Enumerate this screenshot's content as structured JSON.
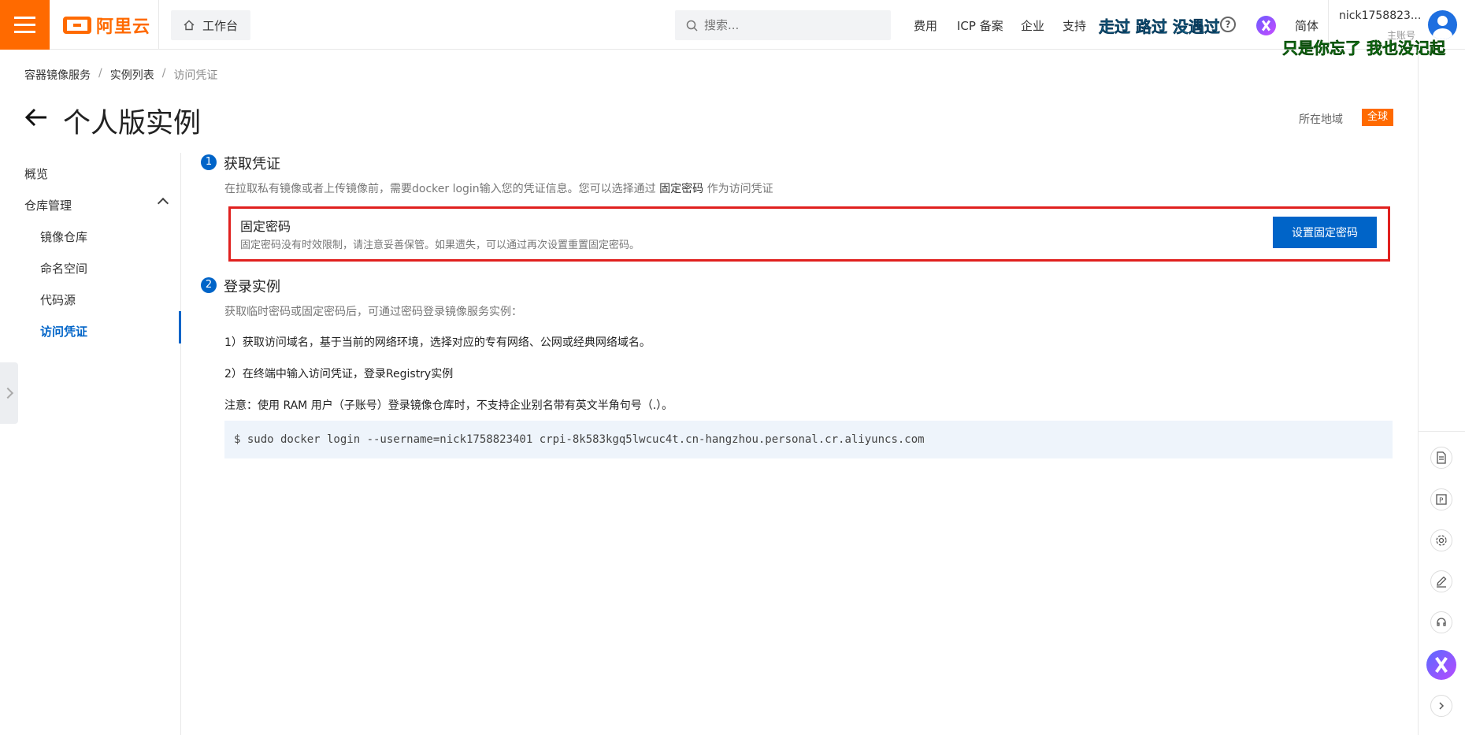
{
  "brand": {
    "logo_text": "阿里云",
    "accent": "#ff6a00",
    "primary": "#0064c8"
  },
  "header": {
    "workbench_label": "工作台",
    "search_placeholder": "搜索...",
    "nav": [
      "费用",
      "ICP 备案",
      "企业",
      "支持"
    ],
    "overlay_line1": "走过 路过 没遇过",
    "overlay_line2": "只是你忘了 我也没记起",
    "language": "简体",
    "user_name": "nick1758823...",
    "user_role": "主账号"
  },
  "breadcrumb": [
    "容器镜像服务",
    "实例列表",
    "访问凭证"
  ],
  "page": {
    "title": "个人版实例",
    "region_label": "所在地域",
    "region_value": "全球"
  },
  "sidebar": {
    "items": [
      {
        "label": "概览"
      },
      {
        "label": "仓库管理"
      },
      {
        "label": "镜像仓库"
      },
      {
        "label": "命名空间"
      },
      {
        "label": "代码源"
      },
      {
        "label": "访问凭证"
      }
    ]
  },
  "step1": {
    "number": "1",
    "title": "获取凭证",
    "desc_prefix": "在拉取私有镜像或者上传镜像前，需要docker login输入您的凭证信息。您可以选择通过",
    "desc_bold": "固定密码",
    "desc_suffix": "作为访问凭证",
    "card_title": "固定密码",
    "card_desc": "固定密码没有时效限制，请注意妥善保管。如果遗失，可以通过再次设置重置固定密码。",
    "button_label": "设置固定密码"
  },
  "step2": {
    "number": "2",
    "title": "登录实例",
    "desc": "获取临时密码或固定密码后，可通过密码登录镜像服务实例：",
    "line1": "1）获取访问域名，基于当前的网络环境，选择对应的专有网络、公网或经典网络域名。",
    "line2": "2）在终端中输入访问凭证，登录Registry实例",
    "note": "注意：使用 RAM 用户（子账号）登录镜像仓库时，不支持企业别名带有英文半角句号（.）。",
    "command": "$ sudo docker login --username=nick1758823401 crpi-8k583kgq5lwcuc4t.cn-hangzhou.personal.cr.aliyuncs.com"
  }
}
